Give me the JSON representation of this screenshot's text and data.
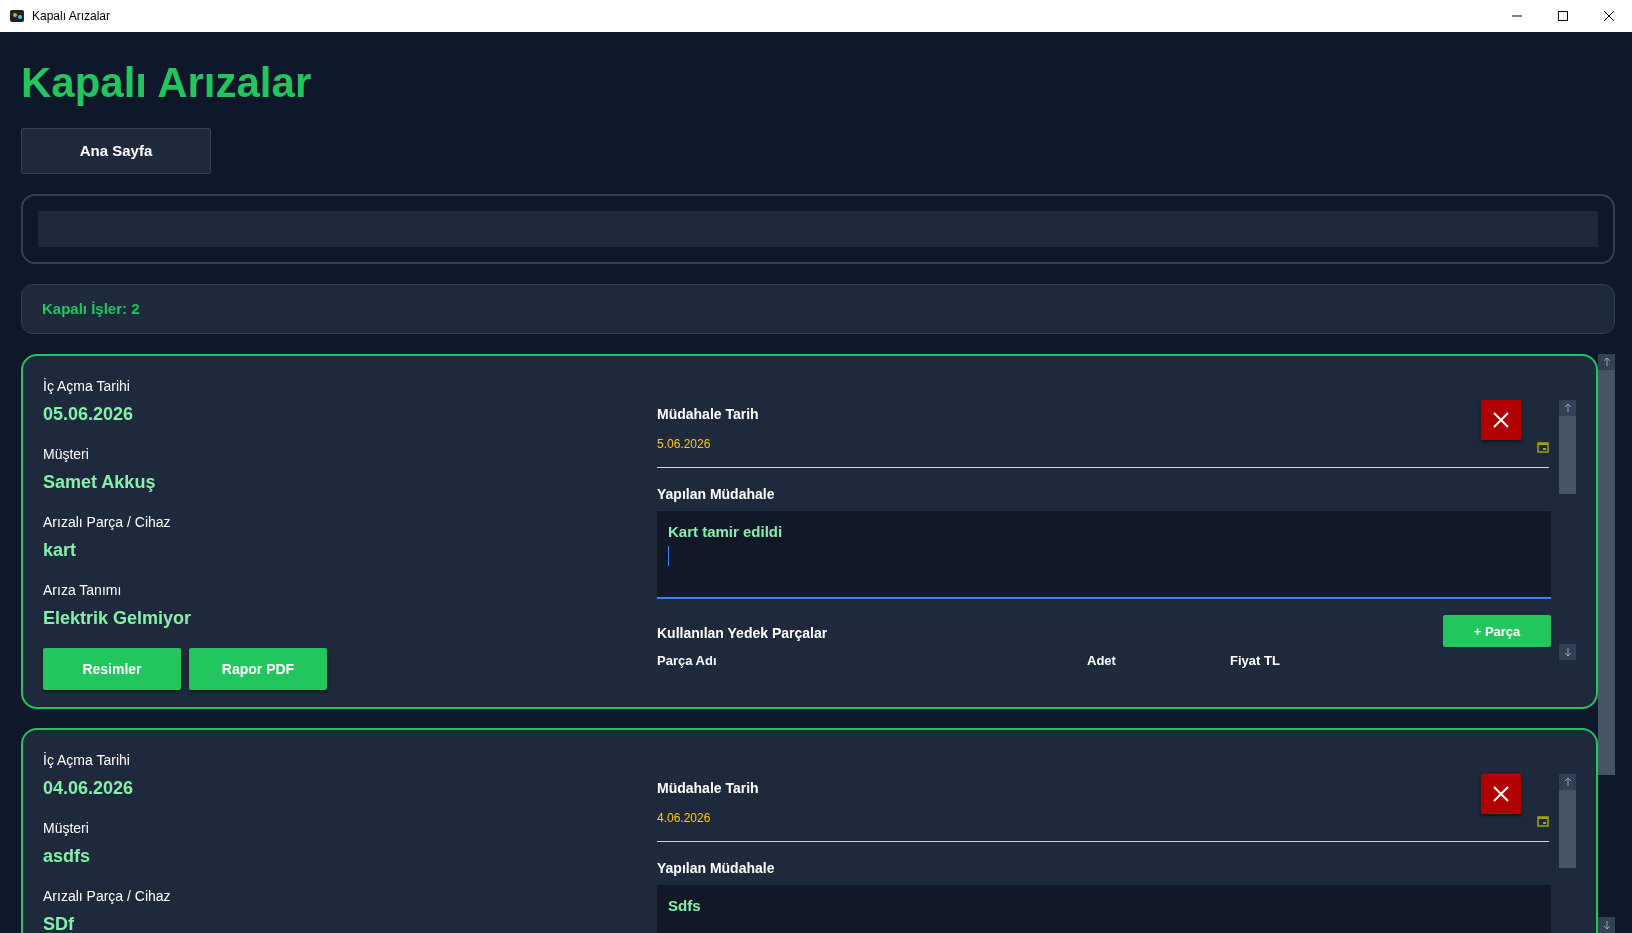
{
  "window": {
    "title": "Kapalı Arızalar"
  },
  "heading": "Kapalı Arızalar",
  "nav_button": "Ana Sayfa",
  "summary": "Kapalı İşler: 2",
  "records": [
    {
      "fields": [
        {
          "label": "İç Açma Tarihi",
          "value": "05.06.2026"
        },
        {
          "label": "Müşteri",
          "value": "Samet Akkuş"
        },
        {
          "label": "Arızalı Parça / Cihaz",
          "value": "kart"
        },
        {
          "label": "Arıza Tanımı",
          "value": "Elektrik Gelmiyor"
        }
      ],
      "buttons": [
        "Resimler",
        "Rapor PDF"
      ],
      "intervention": {
        "date_label": "Müdahale Tarih",
        "date": "5.06.2026",
        "description_label": "Yapılan Müdahale",
        "description": "Kart tamir edildi",
        "focused": true,
        "parts_label": "Kullanılan Yedek Parçalar",
        "add_part_button": "+ Parça",
        "columns": [
          "Parça Adı",
          "Adet",
          "Fiyat TL"
        ]
      }
    },
    {
      "fields": [
        {
          "label": "İç Açma Tarihi",
          "value": "04.06.2026"
        },
        {
          "label": "Müşteri",
          "value": "asdfs"
        },
        {
          "label": "Arızalı Parça / Cihaz",
          "value": "SDf"
        }
      ],
      "intervention": {
        "date_label": "Müdahale Tarih",
        "date": "4.06.2026",
        "description_label": "Yapılan Müdahale",
        "description": "Sdfs",
        "focused": false
      }
    }
  ]
}
